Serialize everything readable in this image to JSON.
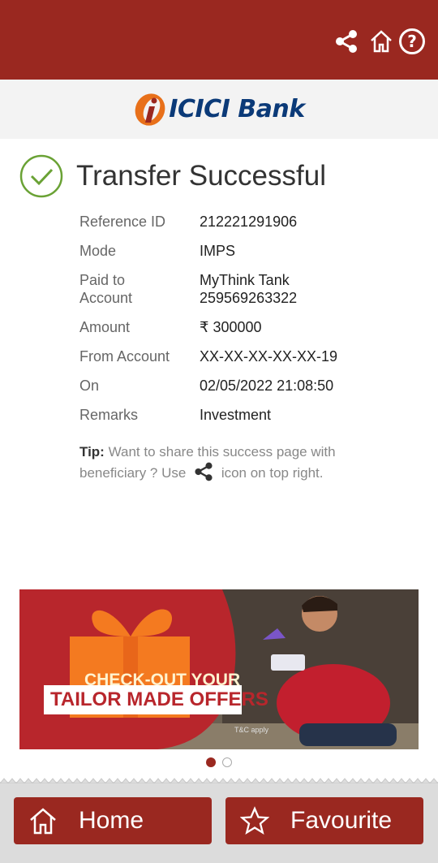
{
  "header": {
    "share_icon": "share-icon",
    "home_icon": "home-icon",
    "help_icon": "help-icon"
  },
  "brand": {
    "name": "ICICI Bank",
    "color": "#0b3a78",
    "accent": "#e8701a"
  },
  "status": {
    "title": "Transfer Successful",
    "icon": "check-circle-icon",
    "color": "#6aa235"
  },
  "details": [
    {
      "label": "Reference ID",
      "value": "212221291906"
    },
    {
      "label": "Mode",
      "value": "IMPS"
    },
    {
      "label": "Paid to Account",
      "value": "MyThink Tank 259569263322"
    },
    {
      "label": "Amount",
      "value": "₹ 300000"
    },
    {
      "label": "From Account",
      "value": "XX-XX-XX-XX-XX-19"
    },
    {
      "label": "On",
      "value": "02/05/2022 21:08:50"
    },
    {
      "label": "Remarks",
      "value": "Investment"
    }
  ],
  "tip": {
    "label": "Tip:",
    "text_before": "Want to share this success page with beneficiary ? Use",
    "text_after": "icon on top right."
  },
  "banner": {
    "line1": "CHECK-OUT YOUR",
    "line2": "TAILOR MADE OFFERS",
    "small": "T&C apply"
  },
  "carousel": {
    "total": 2,
    "active": 1
  },
  "footer": {
    "home_label": "Home",
    "favourite_label": "Favourite"
  },
  "colors": {
    "primary": "#9a2820",
    "orange": "#f47a20"
  }
}
